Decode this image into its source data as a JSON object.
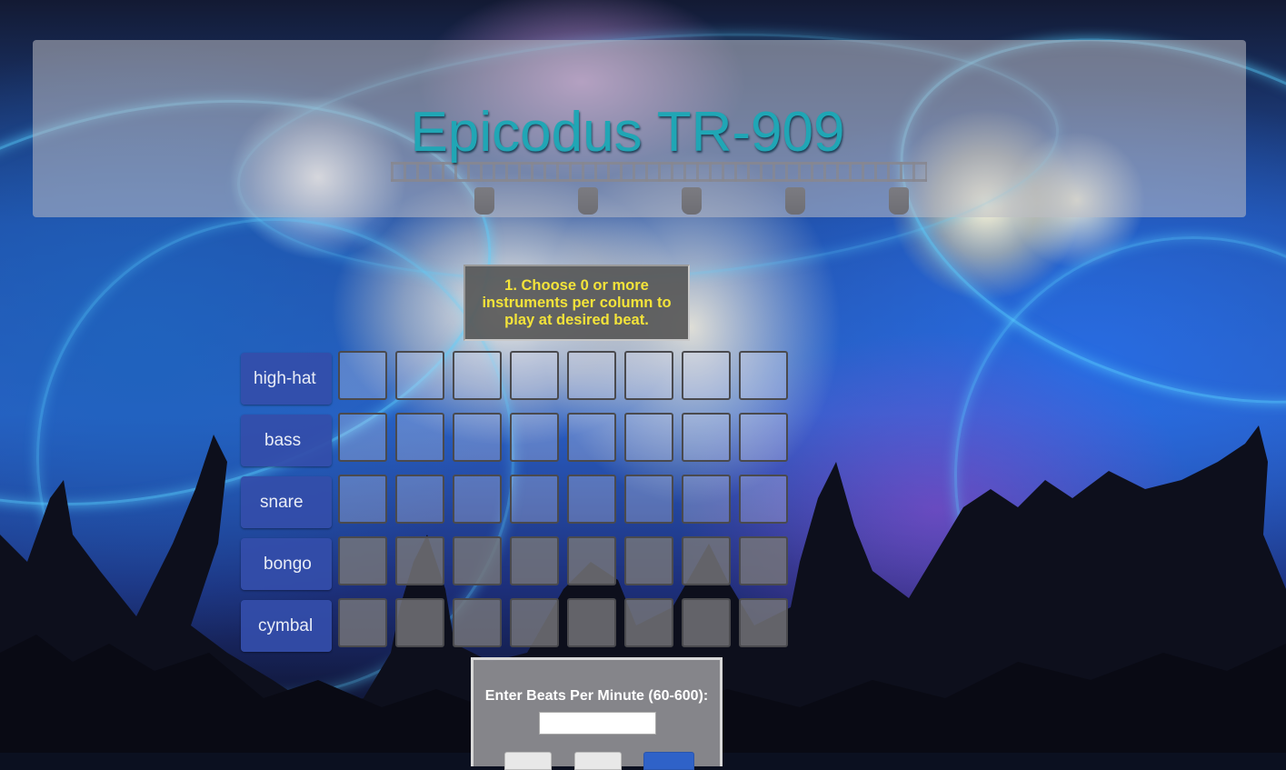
{
  "app": {
    "title": "Epicodus TR-909"
  },
  "instructions": {
    "text": "1. Choose 0 or more instruments per column to play at desired beat."
  },
  "sequencer": {
    "instruments": [
      {
        "label": "high-hat",
        "steps": [
          false,
          false,
          false,
          false,
          false,
          false,
          false,
          false
        ]
      },
      {
        "label": "bass",
        "steps": [
          false,
          false,
          false,
          false,
          false,
          false,
          false,
          false
        ]
      },
      {
        "label": "snare",
        "steps": [
          false,
          false,
          false,
          false,
          false,
          false,
          false,
          false
        ]
      },
      {
        "label": "bongo",
        "steps": [
          false,
          false,
          false,
          false,
          false,
          false,
          false,
          false
        ]
      },
      {
        "label": "cymbal",
        "steps": [
          false,
          false,
          false,
          false,
          false,
          false,
          false,
          false
        ]
      }
    ]
  },
  "bpm": {
    "label": "Enter Beats Per Minute (60-600):",
    "value": ""
  },
  "colors": {
    "title": "#20a6b5",
    "instructions_text": "#f3e33a",
    "instrument_button": "#344eaa",
    "action_button": "#2f62c8"
  }
}
